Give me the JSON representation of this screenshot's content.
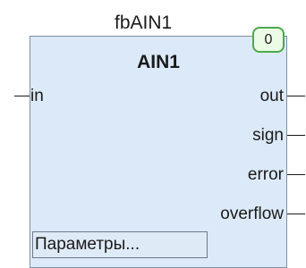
{
  "function_block": {
    "instance_name": "fbAIN1",
    "type_name": "AIN1",
    "execution_order": "0",
    "inputs": [
      {
        "label": "in"
      }
    ],
    "outputs": [
      {
        "label": "out"
      },
      {
        "label": "sign"
      },
      {
        "label": "error"
      },
      {
        "label": "overflow"
      }
    ],
    "params_button_label": "Параметры..."
  }
}
